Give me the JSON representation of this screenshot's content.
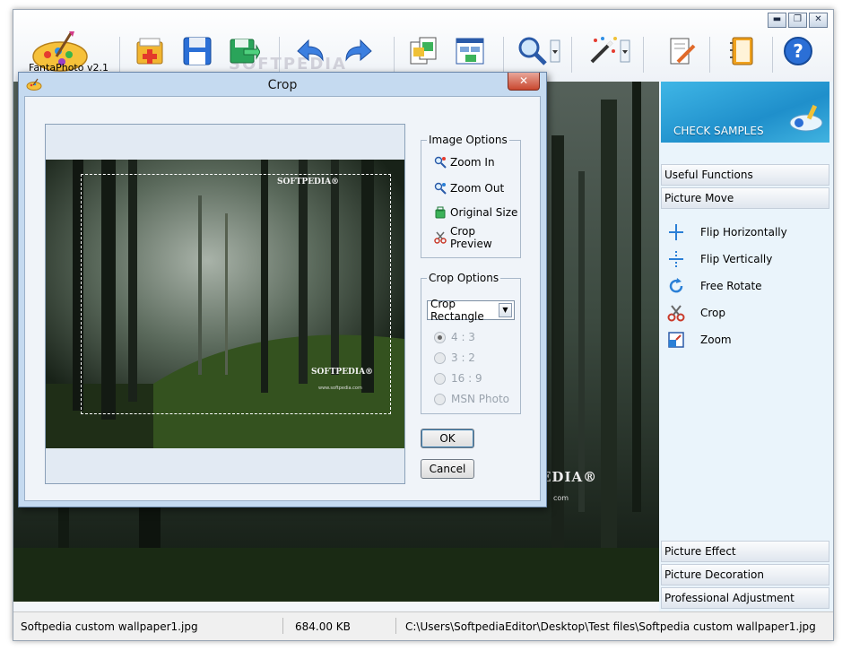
{
  "app": {
    "name": "FantaPhoto v2.1",
    "watermark": "SOFTPEDIA",
    "window_controls": {
      "minimize": "▬",
      "maximize": "❐",
      "close": "✕"
    }
  },
  "toolbar": {
    "buttons": [
      {
        "name": "open-icon"
      },
      {
        "name": "save-icon"
      },
      {
        "name": "export-icon"
      },
      {
        "name": "undo-icon"
      },
      {
        "name": "redo-icon"
      },
      {
        "name": "compare-icon"
      },
      {
        "name": "batch-icon"
      },
      {
        "name": "zoom-icon"
      },
      {
        "name": "magic-wand-icon"
      },
      {
        "name": "edit-icon"
      },
      {
        "name": "notebook-icon"
      },
      {
        "name": "help-icon"
      }
    ]
  },
  "side_panel": {
    "banner": "CHECK SAMPLES",
    "sections": {
      "useful_functions": "Useful Functions",
      "picture_move": "Picture Move",
      "picture_effect": "Picture Effect",
      "picture_decoration": "Picture Decoration",
      "professional_adjustment": "Professional Adjustment"
    },
    "items": [
      {
        "label": "Flip  Horizontally",
        "icon": "flip-horizontal-icon"
      },
      {
        "label": "Flip  Vertically",
        "icon": "flip-vertical-icon"
      },
      {
        "label": "Free  Rotate",
        "icon": "rotate-icon"
      },
      {
        "label": "Crop",
        "icon": "scissors-icon"
      },
      {
        "label": "Zoom",
        "icon": "zoom-icon"
      }
    ]
  },
  "dialog": {
    "title": "Crop",
    "close": "✕",
    "preview_watermark_top": "SOFTPEDIA®",
    "preview_watermark_bottom": "SOFTPEDIA®",
    "preview_url": "www.softpedia.com",
    "image_options": {
      "title": "Image Options",
      "zoom_in": "Zoom In",
      "zoom_out": "Zoom Out",
      "original_size": "Original Size",
      "crop_preview": "Crop Preview"
    },
    "crop_options": {
      "title": "Crop Options",
      "select_value": "Crop Rectangle",
      "ratios": [
        {
          "label": "4 : 3",
          "selected": true
        },
        {
          "label": "3 : 2",
          "selected": false
        },
        {
          "label": "16 : 9",
          "selected": false
        },
        {
          "label": "MSN Photo",
          "selected": false
        }
      ]
    },
    "ok": "OK",
    "cancel": "Cancel"
  },
  "canvas": {
    "watermark": "EDIA®",
    "url": "com"
  },
  "status_bar": {
    "filename": "Softpedia custom wallpaper1.jpg",
    "size": "684.00 KB",
    "path": "C:\\Users\\SoftpediaEditor\\Desktop\\Test files\\Softpedia custom wallpaper1.jpg"
  }
}
